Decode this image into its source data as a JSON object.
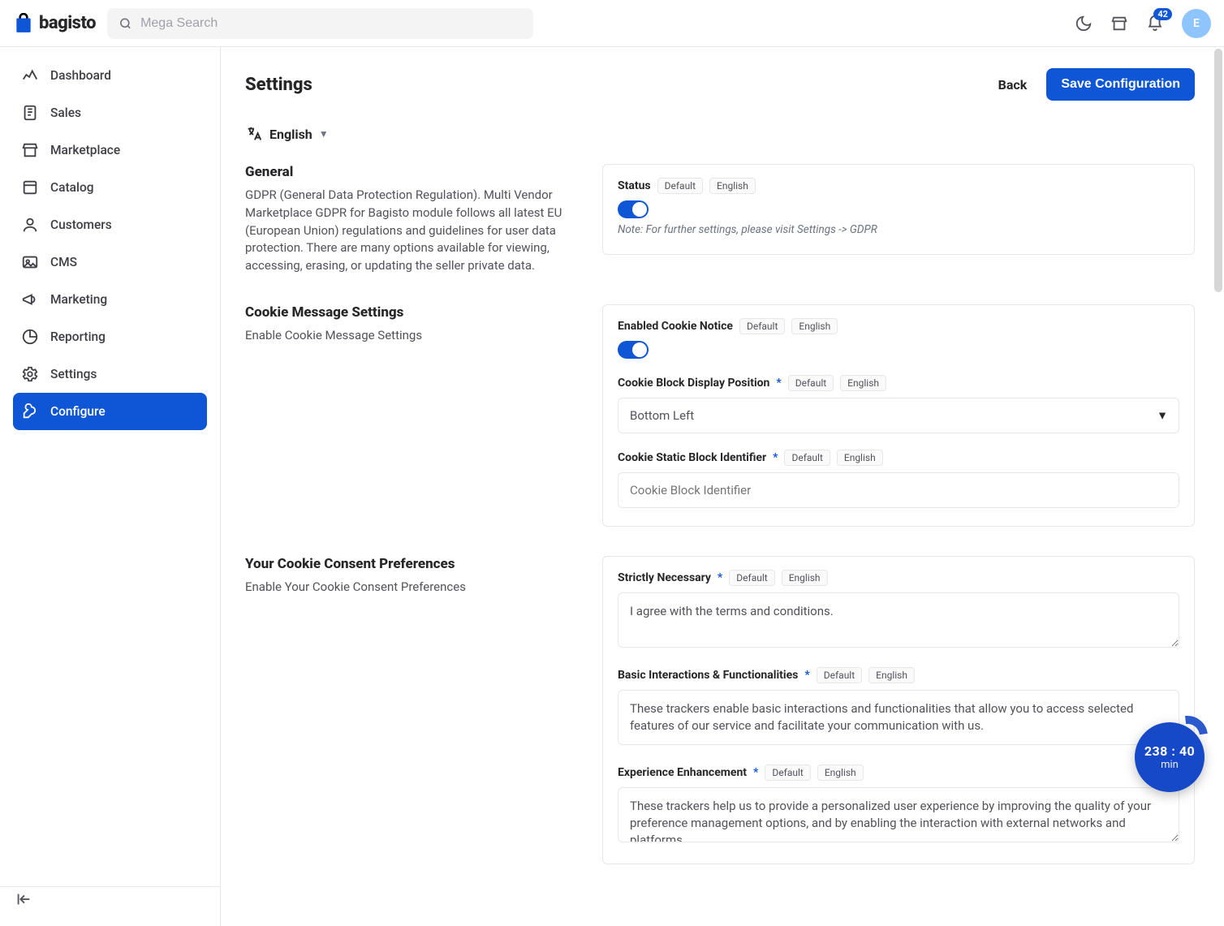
{
  "brand": {
    "name": "bagisto"
  },
  "search": {
    "placeholder": "Mega Search"
  },
  "notifications": {
    "count": "42"
  },
  "avatar": {
    "initial": "E"
  },
  "sidebar": {
    "items": [
      {
        "label": "Dashboard"
      },
      {
        "label": "Sales"
      },
      {
        "label": "Marketplace"
      },
      {
        "label": "Catalog"
      },
      {
        "label": "Customers"
      },
      {
        "label": "CMS"
      },
      {
        "label": "Marketing"
      },
      {
        "label": "Reporting"
      },
      {
        "label": "Settings"
      },
      {
        "label": "Configure"
      }
    ]
  },
  "page": {
    "title": "Settings",
    "back": "Back",
    "save": "Save Configuration",
    "language": "English"
  },
  "chips": {
    "default": "Default",
    "english": "English"
  },
  "sections": {
    "general": {
      "title": "General",
      "desc": "GDPR (General Data Protection Regulation). Multi Vendor Marketplace GDPR for Bagisto module follows all latest EU (European Union) regulations and guidelines for user data protection. There are many options available for viewing, accessing, erasing, or updating the seller private data.",
      "status_label": "Status",
      "note": "Note: For further settings, please visit Settings -> GDPR"
    },
    "cookie": {
      "title": "Cookie Message Settings",
      "desc": "Enable Cookie Message Settings",
      "enabled_label": "Enabled Cookie Notice",
      "position_label": "Cookie Block Display Position",
      "position_value": "Bottom Left",
      "identifier_label": "Cookie Static Block Identifier",
      "identifier_placeholder": "Cookie Block Identifier"
    },
    "consent": {
      "title": "Your Cookie Consent Preferences",
      "desc": "Enable Your Cookie Consent Preferences",
      "strict_label": "Strictly Necessary",
      "strict_value": "I agree with the terms and conditions.",
      "basic_label": "Basic Interactions & Functionalities",
      "basic_value": "These trackers enable basic interactions and functionalities that allow you to access selected features of our service and facilitate your communication with us.",
      "exp_label": "Experience Enhancement",
      "exp_value": "These trackers help us to provide a personalized user experience by improving the quality of your preference management options, and by enabling the interaction with external networks and platforms."
    }
  },
  "timer": {
    "value": "238 : 40",
    "unit": "min"
  }
}
